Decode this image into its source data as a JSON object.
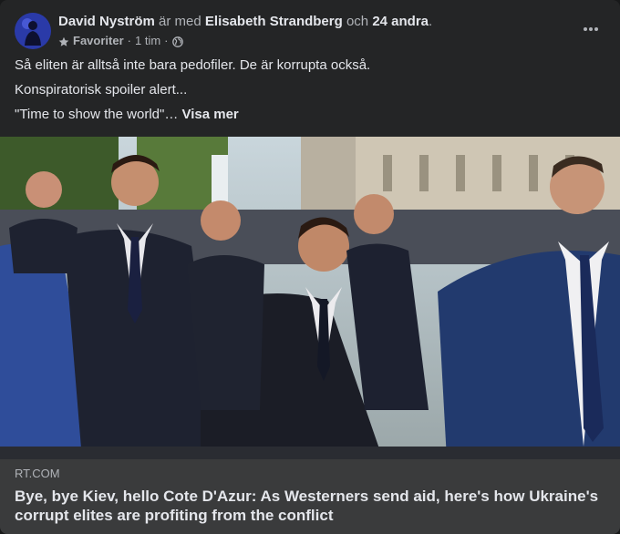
{
  "post": {
    "author": "David Nyström",
    "with_text": "är med",
    "tagged": "Elisabeth Strandberg",
    "and_text": "och",
    "others": "24 andra",
    "period": ".",
    "audience": "Favoriter",
    "separator": "·",
    "time": "1 tim",
    "separator2": "·",
    "paragraphs": [
      "Så eliten är alltså inte bara pedofiler. De är korrupta också.",
      "Konspiratorisk spoiler alert...",
      "\"Time to show the world\"…"
    ],
    "see_more": "Visa mer",
    "icons": {
      "audience_icon": "star-icon",
      "privacy_icon": "globe-icon",
      "more_icon": "more-horizontal-icon"
    }
  },
  "link": {
    "domain": "RT.COM",
    "title": "Bye, bye Kiev, hello Cote D'Azur: As Westerners send aid, here's how Ukraine's corrupt elites are profiting from the conflict"
  },
  "colors": {
    "card_bg": "#242526",
    "link_bg": "#3a3b3c",
    "primary_text": "#e4e6eb",
    "secondary_text": "#b0b3b8"
  }
}
